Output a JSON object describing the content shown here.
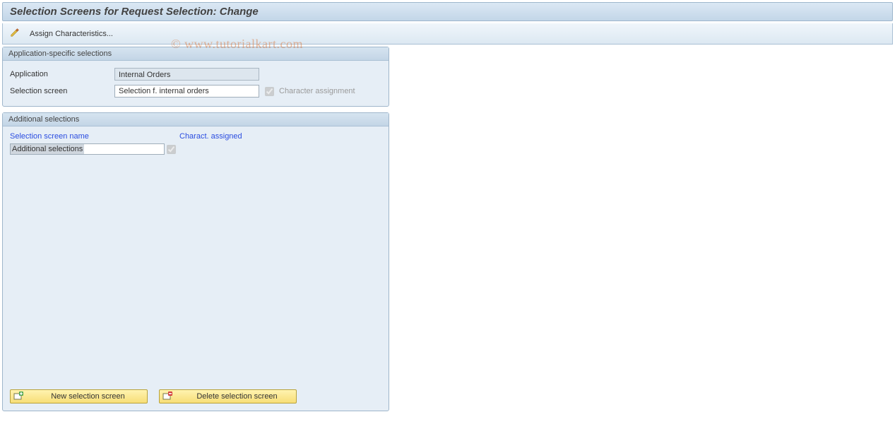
{
  "title": "Selection Screens for Request Selection: Change",
  "toolbar": {
    "assign_label": "Assign Characteristics..."
  },
  "group1": {
    "title": "Application-specific selections",
    "application_label": "Application",
    "application_value": "Internal Orders",
    "selscreen_label": "Selection screen",
    "selscreen_value": "Selection f. internal orders",
    "char_assign_label": "Character assignment"
  },
  "group2": {
    "title": "Additional selections",
    "col_name": "Selection screen name",
    "col_charact": "Charact. assigned",
    "row0_name": "Additional selections",
    "btn_new": "New selection screen",
    "btn_delete": "Delete selection screen"
  },
  "watermark": "© www.tutorialkart.com"
}
